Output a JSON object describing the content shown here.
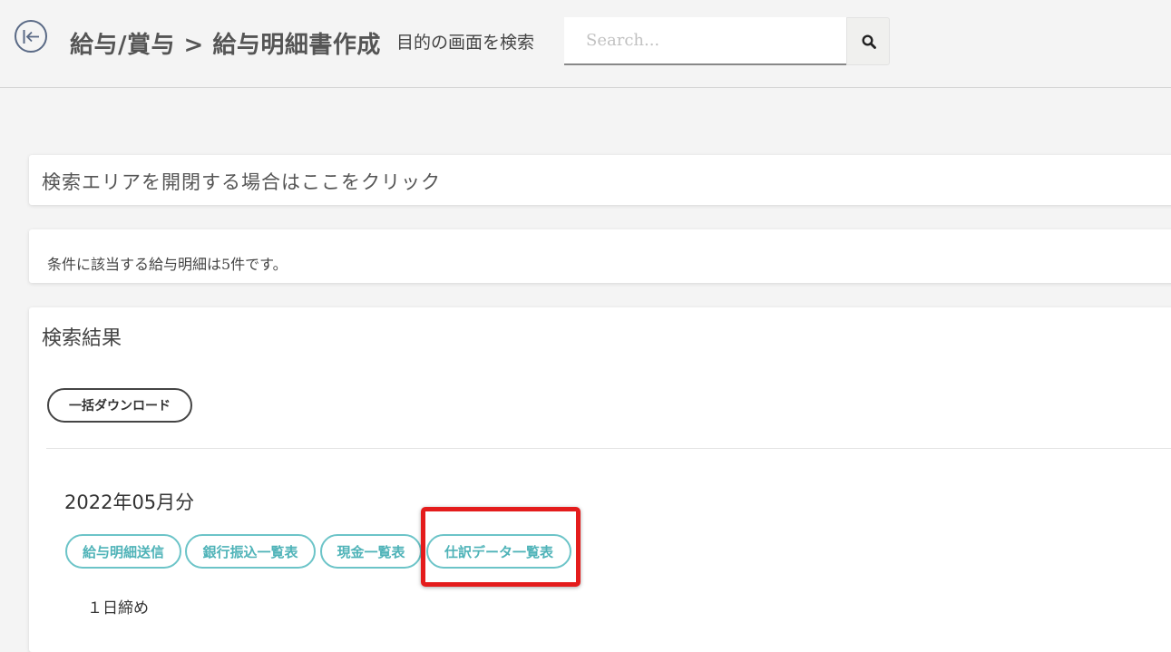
{
  "header": {
    "breadcrumb": "給与/賞与 > 給与明細書作成",
    "search_label": "目的の画面を検索",
    "search_placeholder": "Search...",
    "search_value": ""
  },
  "search_area": {
    "toggle_text": "検索エリアを開閉する場合はここをクリック"
  },
  "result_count": {
    "text": "条件に該当する給与明細は5件です。"
  },
  "results": {
    "title": "検索結果",
    "bulk_download_label": "一括ダウンロード",
    "month": "2022年05月分",
    "actions": [
      {
        "label": "給与明細送信"
      },
      {
        "label": "銀行振込一覧表"
      },
      {
        "label": "現金一覧表"
      },
      {
        "label": "仕訳データ一覧表",
        "highlighted": true
      }
    ],
    "closing_day": "１日締め"
  },
  "colors": {
    "accent_teal": "#4fb3b8",
    "highlight_red": "#e41c1c",
    "background": "#f4f4f4"
  },
  "icons": {
    "back": "collapse-left-icon",
    "search": "magnifier-icon"
  }
}
